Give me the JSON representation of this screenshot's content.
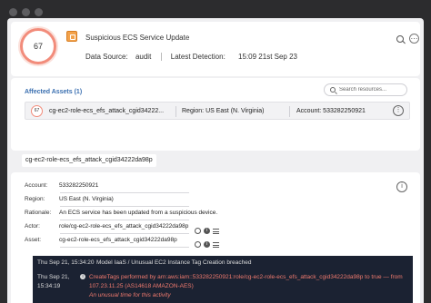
{
  "header": {
    "score": "67",
    "title": "Suspicious ECS Service Update",
    "data_source_label": "Data Source:",
    "data_source_value": "audit",
    "latest_detection_label": "Latest Detection:",
    "latest_detection_value": "15:09 21st Sep 23"
  },
  "assets": {
    "title": "Affected Assets (1)",
    "search_placeholder": "Search resources...",
    "rows": [
      {
        "score": "67",
        "name": "cg-ec2-role-ecs_efs_attack_cgid34222...",
        "region": "Region: US East (N. Virginia)",
        "account": "Account: 533282250921"
      }
    ]
  },
  "tab": {
    "label": "cg-ec2-role-ecs_efs_attack_cgid34222da98p"
  },
  "details": {
    "account_label": "Account:",
    "account_value": "533282250921",
    "region_label": "Region:",
    "region_value": "US East (N. Virginia)",
    "rationale_label": "Rationale:",
    "rationale_value": "An ECS service has been updated from a suspicious device.",
    "actor_label": "Actor:",
    "actor_value": "role/cg-ec2-role-ecs_efs_attack_cgid34222da98p",
    "asset_label": "Asset:",
    "asset_value": "cg-ec2-role-ecs_efs_attack_cgid34222da98p"
  },
  "log": {
    "entry1_time": "Thu Sep 21, 15:34:20",
    "entry1_message": "Model IaaS / Unusual EC2 Instance Tag Creation breached",
    "entry2_time_line1": "Thu Sep 21,",
    "entry2_time_line2": "15:34:19",
    "entry2_line1": "CreateTags performed by arn:aws:iam::533282250921:role/cg-ec2-role-ecs_efs_attack_cgid34222da98p to true — from",
    "entry2_line2": "107.23.11.25 (AS14618 AMAZON-AES)",
    "entry2_note": "An unusual time for this activity"
  },
  "colors": {
    "accent": "#3a6fb0",
    "score_ring": "#f28c7b",
    "log_bg": "#1b2232",
    "log_alert": "#f07a6e"
  }
}
